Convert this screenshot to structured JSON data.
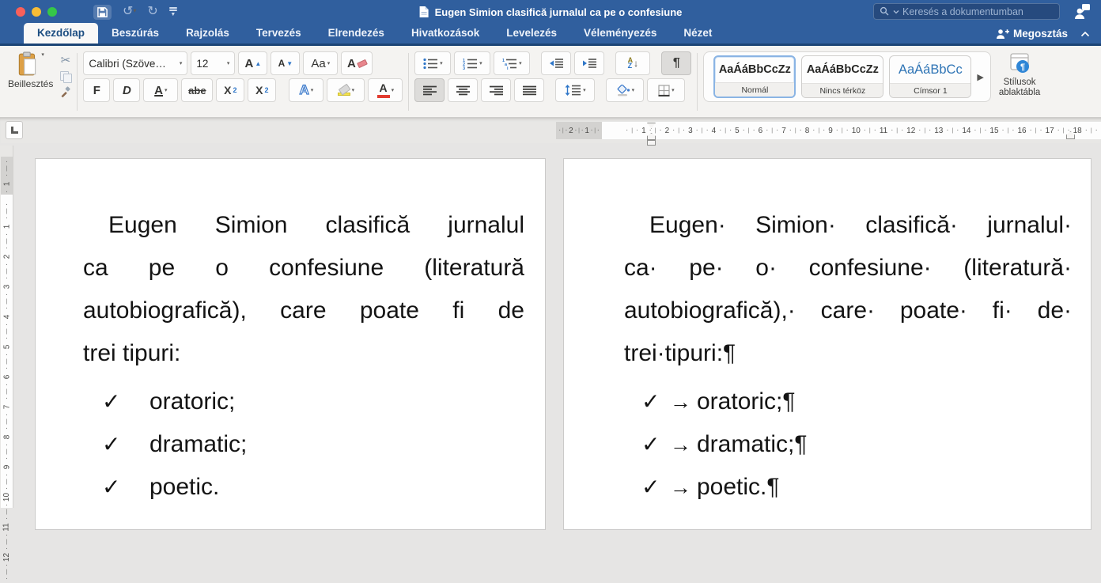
{
  "titlebar": {
    "title": "Eugen Simion clasifică jurnalul ca pe o confesiune",
    "search_placeholder": "Keresés a dokumentumban"
  },
  "tabs": [
    "Kezdőlap",
    "Beszúrás",
    "Rajzolás",
    "Tervezés",
    "Elrendezés",
    "Hivatkozások",
    "Levelezés",
    "Véleményezés",
    "Nézet"
  ],
  "share_label": "Megosztás",
  "ribbon": {
    "paste_label": "Beillesztés",
    "font_name": "Calibri (Szöve…",
    "font_size": "12",
    "grow_font": "A",
    "grow_mark": "▲",
    "shrink_font": "A",
    "shrink_mark": "▼",
    "change_case": "Aa",
    "clear_format": "A",
    "bold": "F",
    "italic": "D",
    "underline": "A",
    "strikethrough": "abe",
    "sub_base": "X",
    "sub_mark": "2",
    "sup_base": "X",
    "sup_mark": "2",
    "text_effects": "A",
    "font_color": "A",
    "sort_a": "A",
    "sort_z": "Z",
    "sort_arrow": "↓",
    "pilcrow": "¶",
    "styles": [
      {
        "sample": "AaÁáBbCcZz",
        "name": "Normál"
      },
      {
        "sample": "AaÁáBbCcZz",
        "name": "Nincs térköz"
      },
      {
        "sample": "AaÁáBbCc",
        "name": "Címsor 1"
      }
    ],
    "more_styles": "▶",
    "styles_pane_line1": "Stílusok",
    "styles_pane_line2": "ablaktábla"
  },
  "ruler": {
    "h_margin": [
      "2",
      "1"
    ],
    "h_numbers": [
      "1",
      "2",
      "3",
      "4",
      "5",
      "6",
      "7",
      "8",
      "9",
      "10",
      "11",
      "12",
      "13",
      "14",
      "15",
      "16",
      "17",
      "18"
    ],
    "v_margin": [
      "1"
    ],
    "v_numbers": [
      "1",
      "2",
      "3",
      "4",
      "5",
      "6",
      "7",
      "8",
      "9",
      "10",
      "11",
      "12"
    ]
  },
  "document": {
    "page1": {
      "para_lines": [
        "Eugen Simion clasifică jurnalul",
        "ca pe o confesiune (literatură",
        "autobiografică), care poate fi de",
        "trei tipuri:"
      ],
      "bullet": "✓",
      "list": [
        "oratoric;",
        "dramatic;",
        "poetic."
      ]
    },
    "page2": {
      "para_lines": [
        "Eugen· Simion· clasifică· jurnalul·",
        "ca· pe· o· confesiune· (literatură·",
        "autobiografică),· care· poate· fi· de·",
        "trei·tipuri:¶"
      ],
      "bullet": "✓",
      "tab_mark": "→",
      "list": [
        "oratoric;¶",
        "dramatic;¶",
        "poetic.¶"
      ]
    }
  }
}
